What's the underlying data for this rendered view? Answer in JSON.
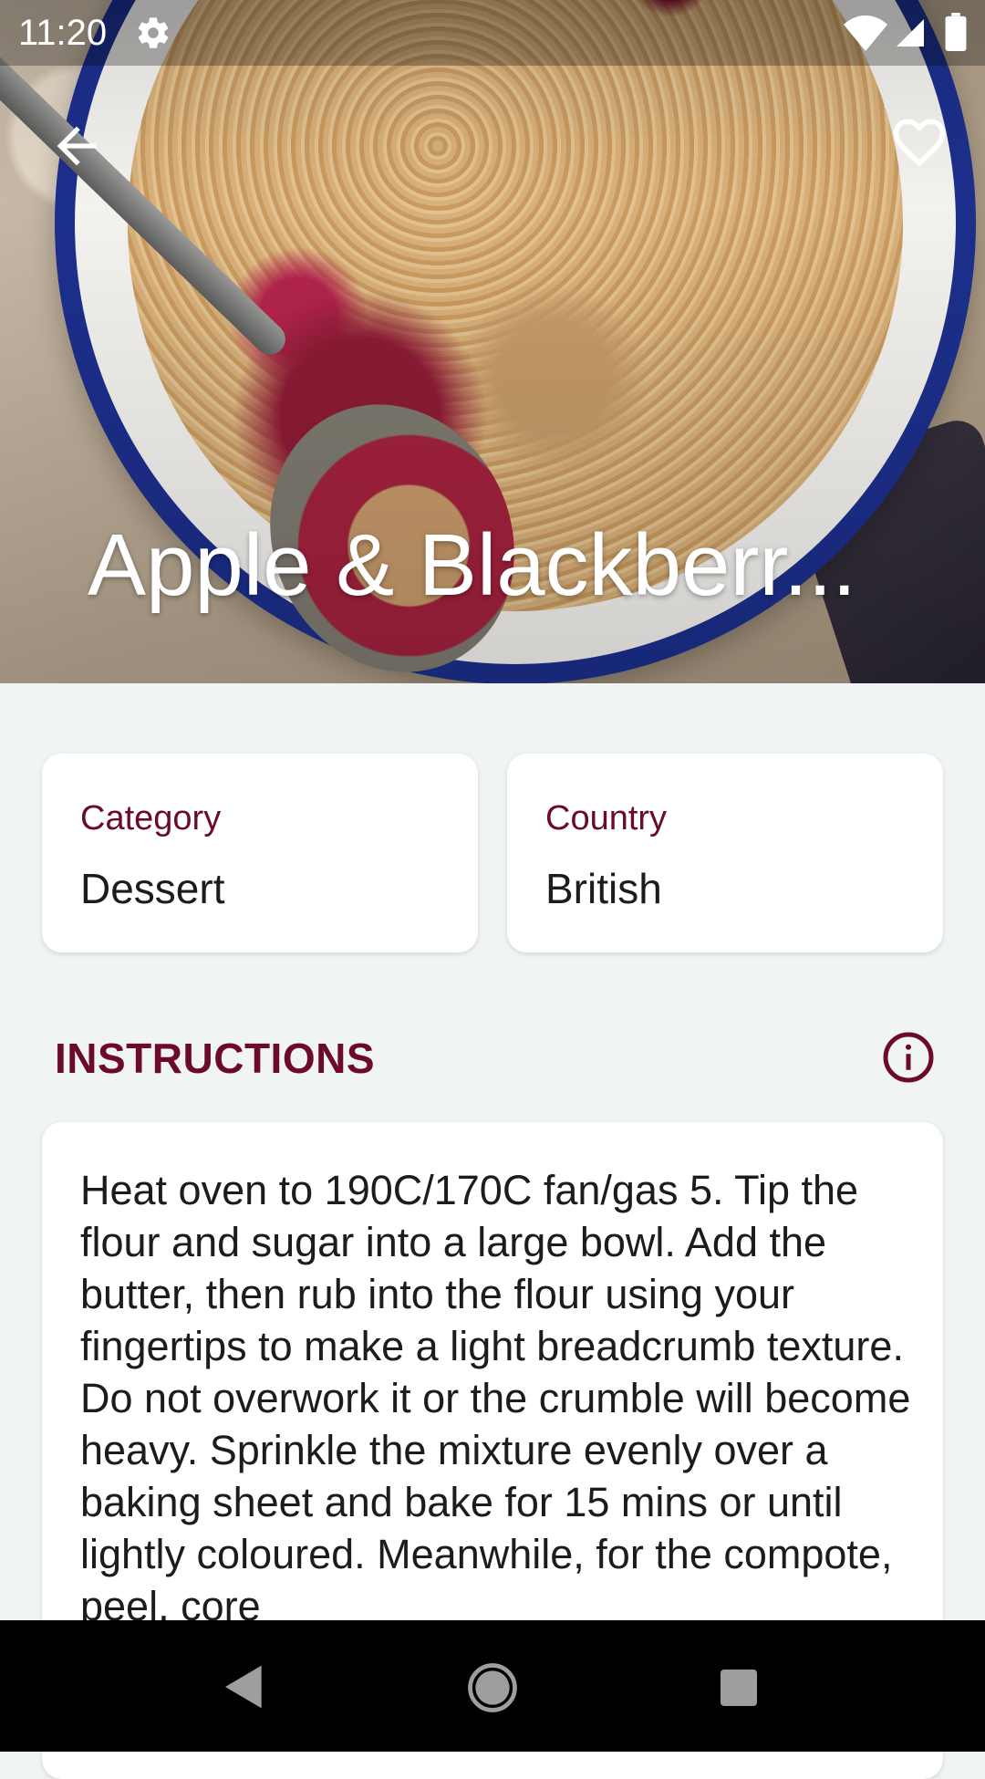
{
  "status_bar": {
    "time": "11:20",
    "icons": [
      "gear-icon",
      "wifi-icon",
      "signal-icon",
      "battery-icon"
    ]
  },
  "toolbar": {
    "back_icon": "arrow-left-icon",
    "favorite_icon": "heart-outline-icon"
  },
  "recipe": {
    "title": "Apple & Blackberr..."
  },
  "details": {
    "category_label": "Category",
    "category_value": "Dessert",
    "country_label": "Country",
    "country_value": "British"
  },
  "instructions": {
    "heading": "INSTRUCTIONS",
    "info_icon": "info-icon",
    "text": "Heat oven to 190C/170C fan/gas 5. Tip the flour and sugar into a large bowl. Add the butter, then rub into the flour using your fingertips to make a light breadcrumb texture. Do not overwork it or the crumble will become heavy. Sprinkle the mixture evenly over a baking sheet and bake for 15 mins or until lightly coloured. Meanwhile, for the compote, peel, core"
  },
  "nav_bar": {
    "icons": [
      "nav-back-icon",
      "nav-home-icon",
      "nav-recents-icon"
    ]
  },
  "colors": {
    "accent": "#6b0a2a",
    "background": "#f1f4f5",
    "card": "#ffffff",
    "text": "#1c1c1c"
  }
}
